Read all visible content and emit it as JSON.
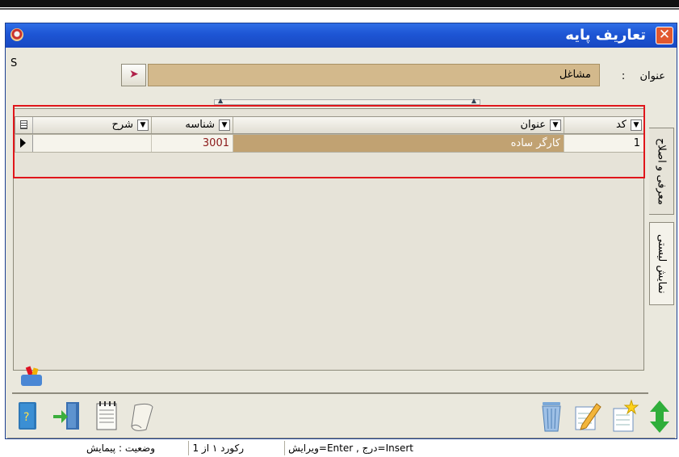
{
  "window": {
    "title": "تعاریف پایه",
    "close_label": "✕"
  },
  "header": {
    "s_label": "S",
    "title_caption": "عنوان",
    "colon": ":",
    "title_value": "مشاغل"
  },
  "grid": {
    "columns": [
      {
        "key": "code",
        "label": "کد"
      },
      {
        "key": "title",
        "label": "عنوان"
      },
      {
        "key": "identifier",
        "label": "شناسه"
      },
      {
        "key": "description",
        "label": "شرح"
      }
    ],
    "rows": [
      {
        "code": "1",
        "title": "کارگر ساده",
        "identifier": "3001",
        "description": ""
      }
    ]
  },
  "side_tabs": {
    "tab1": "معرفی و اصلاح",
    "tab2": "نمایش لیستی"
  },
  "toolbar": {
    "icons": [
      "help-book-icon",
      "exit-door-icon",
      "notepad-icon",
      "scroll-icon",
      "trash-icon",
      "edit-icon",
      "new-document-icon",
      "up-down-arrows-icon"
    ]
  },
  "status": {
    "keys_hint": "Insert=درج , Enter=ویرایش",
    "record": "رکورد ۱ از 1",
    "state": "وضعیت : پیمایش"
  },
  "colors": {
    "titlebar": "#1d55d4",
    "field_bg": "#d3b98c",
    "highlight_box": "#e0161b"
  }
}
